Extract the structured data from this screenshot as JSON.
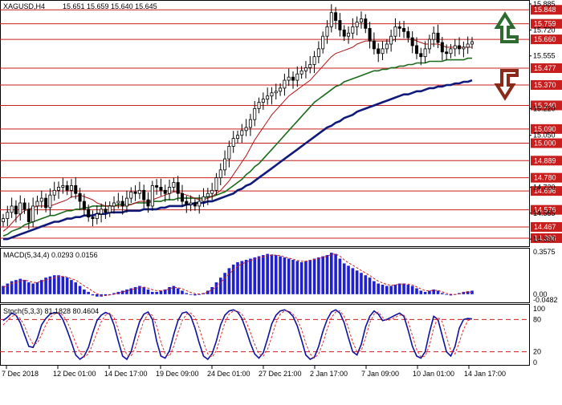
{
  "header": {
    "symbol_tf": "XAGUSD,H4",
    "ohlc": "15.651 15.659 15.640 15.645"
  },
  "chart_data": [
    {
      "type": "candlestick",
      "title": "XAGUSD,H4 15.651 15.659 15.640 15.645",
      "ylim": [
        14.36,
        15.89
      ],
      "price_axis_ticks": [
        {
          "value": 15.885,
          "label": "15.885"
        },
        {
          "value": 15.72,
          "label": "15.720"
        },
        {
          "value": 15.555,
          "label": "15.555"
        },
        {
          "value": 15.22,
          "label": "15.220"
        },
        {
          "value": 15.05,
          "label": "15.050"
        },
        {
          "value": 14.72,
          "label": "14.720"
        },
        {
          "value": 14.555,
          "label": "14.555"
        },
        {
          "value": 14.39,
          "label": "14.390"
        }
      ],
      "levels": [
        {
          "value": 15.848,
          "label": "15.848"
        },
        {
          "value": 15.759,
          "label": "15.759"
        },
        {
          "value": 15.66,
          "label": "15.660"
        },
        {
          "value": 15.477,
          "label": "15.477"
        },
        {
          "value": 15.37,
          "label": "15.370"
        },
        {
          "value": 15.24,
          "label": "15.240"
        },
        {
          "value": 15.09,
          "label": "15.090"
        },
        {
          "value": 15.0,
          "label": "15.000"
        },
        {
          "value": 14.889,
          "label": "14.889"
        },
        {
          "value": 14.78,
          "label": "14.780"
        },
        {
          "value": 14.696,
          "label": "14.696"
        },
        {
          "value": 14.576,
          "label": "14.576"
        },
        {
          "value": 14.467,
          "label": "14.467"
        },
        {
          "value": 14.396,
          "label": "14.396"
        }
      ],
      "close_path": [
        14.52,
        14.56,
        14.6,
        14.55,
        14.62,
        14.58,
        14.5,
        14.6,
        14.63,
        14.65,
        14.59,
        14.67,
        14.7,
        14.72,
        14.73,
        14.7,
        14.73,
        14.68,
        14.63,
        14.58,
        14.53,
        14.52,
        14.55,
        14.58,
        14.56,
        14.6,
        14.62,
        14.63,
        14.6,
        14.65,
        14.69,
        14.68,
        14.7,
        14.64,
        14.6,
        14.73,
        14.72,
        14.7,
        14.68,
        14.72,
        14.75,
        14.68,
        14.63,
        14.61,
        14.62,
        14.6,
        14.63,
        14.66,
        14.68,
        14.7,
        14.78,
        14.83,
        14.9,
        14.98,
        15.03,
        15.05,
        15.08,
        15.1,
        15.15,
        15.22,
        15.26,
        15.28,
        15.3,
        15.32,
        15.33,
        15.35,
        15.4,
        15.42,
        15.4,
        15.44,
        15.46,
        15.48,
        15.5,
        15.55,
        15.6,
        15.68,
        15.74,
        15.83,
        15.78,
        15.72,
        15.68,
        15.7,
        15.74,
        15.77,
        15.79,
        15.73,
        15.65,
        15.6,
        15.57,
        15.6,
        15.63,
        15.68,
        15.74,
        15.73,
        15.71,
        15.67,
        15.62,
        15.57,
        15.55,
        15.6,
        15.66,
        15.7,
        15.64,
        15.58,
        15.57,
        15.6,
        15.62,
        15.6,
        15.61,
        15.63,
        15.645
      ],
      "ma_fast": {
        "color": "#b01515",
        "values": [
          14.44,
          14.46,
          14.49,
          14.52,
          14.55,
          14.57,
          14.58,
          14.59,
          14.6,
          14.6,
          14.6,
          14.6,
          14.61,
          14.62,
          14.63,
          14.64,
          14.66,
          14.66,
          14.67,
          14.66,
          14.65,
          14.64,
          14.62,
          14.61,
          14.6,
          14.6,
          14.6,
          14.6,
          14.6,
          14.6,
          14.61,
          14.62,
          14.63,
          14.63,
          14.63,
          14.64,
          14.65,
          14.66,
          14.67,
          14.68,
          14.69,
          14.69,
          14.68,
          14.67,
          14.66,
          14.65,
          14.64,
          14.64,
          14.65,
          14.66,
          14.68,
          14.7,
          14.73,
          14.76,
          14.8,
          14.84,
          14.88,
          14.92,
          14.97,
          15.02,
          15.06,
          15.1,
          15.14,
          15.18,
          15.21,
          15.24,
          15.27,
          15.3,
          15.32,
          15.34,
          15.36,
          15.38,
          15.4,
          15.43,
          15.46,
          15.49,
          15.52,
          15.55,
          15.57,
          15.58,
          15.59,
          15.6,
          15.61,
          15.63,
          15.64,
          15.65,
          15.65,
          15.65,
          15.65,
          15.65,
          15.65,
          15.65,
          15.66,
          15.66,
          15.66,
          15.66,
          15.66,
          15.65,
          15.64,
          15.63,
          15.63,
          15.63,
          15.63,
          15.62,
          15.61,
          15.61,
          15.61,
          15.61,
          15.61,
          15.61,
          15.61
        ]
      },
      "ma_mid": {
        "color": "#1a6b1a",
        "values": [
          14.41,
          14.42,
          14.44,
          14.45,
          14.46,
          14.48,
          14.49,
          14.5,
          14.51,
          14.52,
          14.53,
          14.54,
          14.54,
          14.55,
          14.56,
          14.57,
          14.57,
          14.58,
          14.58,
          14.59,
          14.59,
          14.6,
          14.6,
          14.6,
          14.6,
          14.6,
          14.6,
          14.61,
          14.61,
          14.61,
          14.61,
          14.62,
          14.62,
          14.62,
          14.62,
          14.63,
          14.63,
          14.63,
          14.64,
          14.64,
          14.64,
          14.65,
          14.65,
          14.65,
          14.65,
          14.65,
          14.65,
          14.65,
          14.66,
          14.66,
          14.67,
          14.68,
          14.69,
          14.71,
          14.73,
          14.75,
          14.77,
          14.8,
          14.82,
          14.85,
          14.87,
          14.9,
          14.93,
          14.96,
          14.99,
          15.02,
          15.05,
          15.08,
          15.11,
          15.14,
          15.17,
          15.2,
          15.23,
          15.26,
          15.28,
          15.3,
          15.32,
          15.34,
          15.36,
          15.37,
          15.39,
          15.4,
          15.41,
          15.42,
          15.43,
          15.44,
          15.45,
          15.46,
          15.46,
          15.47,
          15.47,
          15.48,
          15.48,
          15.49,
          15.49,
          15.5,
          15.5,
          15.51,
          15.51,
          15.51,
          15.52,
          15.52,
          15.52,
          15.52,
          15.53,
          15.53,
          15.53,
          15.53,
          15.53,
          15.54,
          15.54
        ]
      },
      "ma_slow": {
        "color": "#0f1a7a",
        "values": [
          14.39,
          14.39,
          14.4,
          14.41,
          14.42,
          14.43,
          14.44,
          14.45,
          14.46,
          14.47,
          14.48,
          14.49,
          14.5,
          14.5,
          14.51,
          14.52,
          14.52,
          14.53,
          14.53,
          14.54,
          14.54,
          14.54,
          14.55,
          14.55,
          14.55,
          14.56,
          14.56,
          14.56,
          14.56,
          14.57,
          14.57,
          14.57,
          14.57,
          14.58,
          14.58,
          14.58,
          14.58,
          14.59,
          14.59,
          14.6,
          14.6,
          14.6,
          14.6,
          14.61,
          14.61,
          14.62,
          14.62,
          14.62,
          14.63,
          14.63,
          14.64,
          14.65,
          14.66,
          14.67,
          14.68,
          14.7,
          14.71,
          14.73,
          14.74,
          14.76,
          14.78,
          14.8,
          14.82,
          14.84,
          14.86,
          14.88,
          14.9,
          14.92,
          14.94,
          14.96,
          14.98,
          15.0,
          15.02,
          15.04,
          15.06,
          15.08,
          15.1,
          15.11,
          15.13,
          15.14,
          15.16,
          15.17,
          15.18,
          15.2,
          15.21,
          15.22,
          15.23,
          15.24,
          15.25,
          15.26,
          15.27,
          15.28,
          15.29,
          15.3,
          15.31,
          15.31,
          15.32,
          15.33,
          15.33,
          15.34,
          15.35,
          15.35,
          15.36,
          15.36,
          15.37,
          15.37,
          15.38,
          15.38,
          15.39,
          15.39,
          15.4
        ]
      },
      "signals": [
        {
          "direction": "up",
          "color": "#2e6b2e"
        },
        {
          "direction": "down",
          "color": "#8b2a1a"
        }
      ]
    },
    {
      "type": "bar",
      "title": "MACD(5,34,4) 0.0293 0.0156",
      "ylim": [
        -0.0482,
        0.3575
      ],
      "axis_ticks": [
        {
          "value": 0.3575,
          "label": "0.3575"
        },
        {
          "value": 0.0,
          "label": "0.00"
        },
        {
          "value": -0.0482,
          "label": "-0.0482"
        }
      ],
      "bar_color": "#2020d0",
      "signal_color": "#d02020",
      "values": [
        0.07,
        0.09,
        0.11,
        0.12,
        0.13,
        0.12,
        0.1,
        0.09,
        0.1,
        0.12,
        0.14,
        0.15,
        0.16,
        0.16,
        0.15,
        0.14,
        0.12,
        0.1,
        0.07,
        0.04,
        0.02,
        -0.01,
        -0.02,
        -0.02,
        -0.01,
        0.0,
        0.01,
        0.02,
        0.03,
        0.04,
        0.05,
        0.06,
        0.07,
        0.06,
        0.04,
        0.02,
        0.02,
        0.03,
        0.04,
        0.06,
        0.07,
        0.05,
        0.03,
        0.01,
        0.0,
        -0.01,
        0.0,
        0.01,
        0.03,
        0.06,
        0.1,
        0.14,
        0.18,
        0.22,
        0.25,
        0.27,
        0.28,
        0.29,
        0.3,
        0.31,
        0.32,
        0.33,
        0.34,
        0.335,
        0.33,
        0.32,
        0.31,
        0.3,
        0.29,
        0.28,
        0.27,
        0.28,
        0.29,
        0.3,
        0.31,
        0.32,
        0.33,
        0.35,
        0.34,
        0.3,
        0.26,
        0.24,
        0.22,
        0.2,
        0.18,
        0.16,
        0.14,
        0.11,
        0.09,
        0.08,
        0.07,
        0.07,
        0.08,
        0.09,
        0.09,
        0.08,
        0.07,
        0.05,
        0.03,
        0.02,
        0.03,
        0.04,
        0.03,
        0.01,
        0.0,
        -0.01,
        0.0,
        0.01,
        0.02,
        0.025,
        0.03
      ],
      "signal": [
        0.06,
        0.07,
        0.09,
        0.1,
        0.11,
        0.12,
        0.11,
        0.1,
        0.1,
        0.11,
        0.12,
        0.13,
        0.14,
        0.15,
        0.15,
        0.145,
        0.13,
        0.12,
        0.095,
        0.07,
        0.05,
        0.025,
        0.005,
        -0.01,
        -0.012,
        -0.006,
        0.0,
        0.01,
        0.018,
        0.028,
        0.038,
        0.048,
        0.058,
        0.06,
        0.052,
        0.038,
        0.03,
        0.03,
        0.035,
        0.045,
        0.058,
        0.055,
        0.045,
        0.03,
        0.015,
        0.005,
        0.002,
        0.006,
        0.018,
        0.038,
        0.065,
        0.1,
        0.135,
        0.172,
        0.205,
        0.235,
        0.255,
        0.27,
        0.285,
        0.295,
        0.305,
        0.315,
        0.325,
        0.33,
        0.33,
        0.325,
        0.315,
        0.305,
        0.295,
        0.285,
        0.278,
        0.278,
        0.285,
        0.293,
        0.302,
        0.312,
        0.322,
        0.335,
        0.34,
        0.322,
        0.29,
        0.265,
        0.245,
        0.222,
        0.2,
        0.18,
        0.158,
        0.132,
        0.11,
        0.095,
        0.082,
        0.075,
        0.078,
        0.085,
        0.088,
        0.085,
        0.078,
        0.062,
        0.045,
        0.03,
        0.028,
        0.033,
        0.032,
        0.02,
        0.008,
        0.0,
        -0.003,
        0.003,
        0.012,
        0.02,
        0.0156
      ]
    },
    {
      "type": "line",
      "title": "Stoch(5,3,3) 81.1828 80.4604",
      "ylim": [
        0,
        100
      ],
      "axis_ticks": [
        {
          "value": 100,
          "label": "100"
        },
        {
          "value": 80,
          "label": "80"
        },
        {
          "value": 20,
          "label": "20"
        },
        {
          "value": 0,
          "label": "0"
        }
      ],
      "reference_levels": [
        80,
        20
      ],
      "series": [
        {
          "name": "main",
          "color": "#1010a0",
          "values": [
            78,
            84,
            92,
            88,
            74,
            52,
            30,
            28,
            45,
            70,
            82,
            90,
            93,
            92,
            80,
            60,
            38,
            14,
            6,
            12,
            28,
            55,
            78,
            88,
            93,
            90,
            70,
            40,
            12,
            6,
            20,
            50,
            76,
            90,
            94,
            80,
            40,
            12,
            8,
            22,
            52,
            78,
            92,
            94,
            86,
            64,
            36,
            12,
            6,
            16,
            40,
            70,
            88,
            96,
            98,
            94,
            82,
            60,
            36,
            16,
            8,
            18,
            44,
            72,
            88,
            96,
            98,
            94,
            86,
            68,
            42,
            14,
            6,
            10,
            30,
            58,
            80,
            94,
            98,
            92,
            74,
            46,
            20,
            14,
            34,
            66,
            86,
            96,
            90,
            78,
            80,
            84,
            88,
            92,
            86,
            60,
            30,
            12,
            8,
            20,
            56,
            86,
            80,
            50,
            20,
            12,
            30,
            64,
            80,
            82,
            81
          ]
        },
        {
          "name": "signal",
          "color": "#e03030",
          "values": [
            70,
            78,
            86,
            88,
            82,
            68,
            48,
            34,
            36,
            52,
            70,
            84,
            90,
            92,
            88,
            76,
            58,
            36,
            18,
            10,
            16,
            34,
            56,
            76,
            88,
            92,
            84,
            62,
            34,
            14,
            12,
            28,
            54,
            78,
            90,
            88,
            68,
            38,
            16,
            12,
            30,
            56,
            78,
            90,
            92,
            84,
            64,
            38,
            16,
            10,
            22,
            48,
            74,
            90,
            96,
            96,
            90,
            76,
            56,
            34,
            16,
            12,
            24,
            48,
            74,
            90,
            96,
            96,
            90,
            80,
            62,
            36,
            16,
            8,
            16,
            36,
            62,
            84,
            94,
            96,
            86,
            64,
            38,
            20,
            22,
            46,
            74,
            90,
            94,
            84,
            78,
            80,
            84,
            88,
            88,
            76,
            50,
            24,
            10,
            12,
            32,
            64,
            84,
            76,
            48,
            22,
            16,
            38,
            62,
            78,
            80.4604
          ]
        }
      ]
    }
  ],
  "time_axis": {
    "labels": [
      "7 Dec 2018",
      "12 Dec 01:00",
      "14 Dec 17:00",
      "19 Dec 09:00",
      "24 Dec 01:00",
      "27 Dec 21:00",
      "2 Jan 17:00",
      "7 Jan 09:00",
      "10 Jan 01:00",
      "14 Jan 17:00"
    ]
  }
}
